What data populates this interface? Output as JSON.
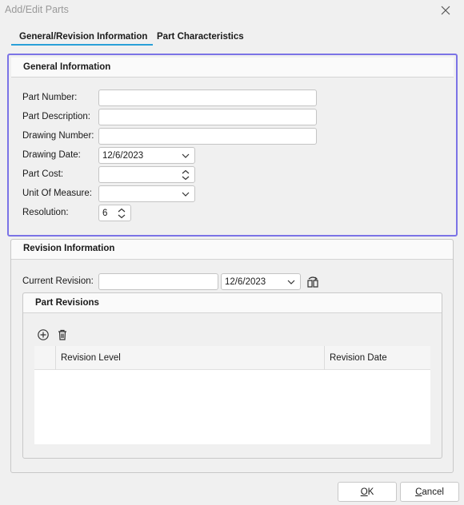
{
  "window": {
    "title": "Add/Edit Parts"
  },
  "tabs": [
    {
      "label": "General/Revision Information",
      "active": true
    },
    {
      "label": "Part Characteristics",
      "active": false
    }
  ],
  "general": {
    "header": "General Information",
    "fields": {
      "part_number": {
        "label": "Part Number:",
        "value": ""
      },
      "part_description": {
        "label": "Part Description:",
        "value": ""
      },
      "drawing_number": {
        "label": "Drawing Number:",
        "value": ""
      },
      "drawing_date": {
        "label": "Drawing Date:",
        "value": "12/6/2023"
      },
      "part_cost": {
        "label": "Part Cost:",
        "value": ""
      },
      "unit_of_measure": {
        "label": "Unit Of Measure:",
        "value": ""
      },
      "resolution": {
        "label": "Resolution:",
        "value": "6"
      }
    }
  },
  "revision": {
    "header": "Revision Information",
    "current_revision_label": "Current Revision:",
    "current_revision_value": "",
    "revision_date": "12/6/2023",
    "part_revisions": {
      "header": "Part Revisions",
      "columns": [
        "Revision Level",
        "Revision Date"
      ],
      "rows": []
    }
  },
  "buttons": {
    "ok_prefix": "",
    "ok_mnemonic": "O",
    "ok_rest": "K",
    "cancel_prefix": "",
    "cancel_mnemonic": "C",
    "cancel_rest": "ancel"
  },
  "colors": {
    "focus_border": "#7b73e6",
    "tab_underline": "#2aa0d8"
  },
  "icons": [
    "close-icon",
    "chevron-down-icon",
    "spinner-icon",
    "copy-revision-icon",
    "add-icon",
    "delete-icon"
  ]
}
